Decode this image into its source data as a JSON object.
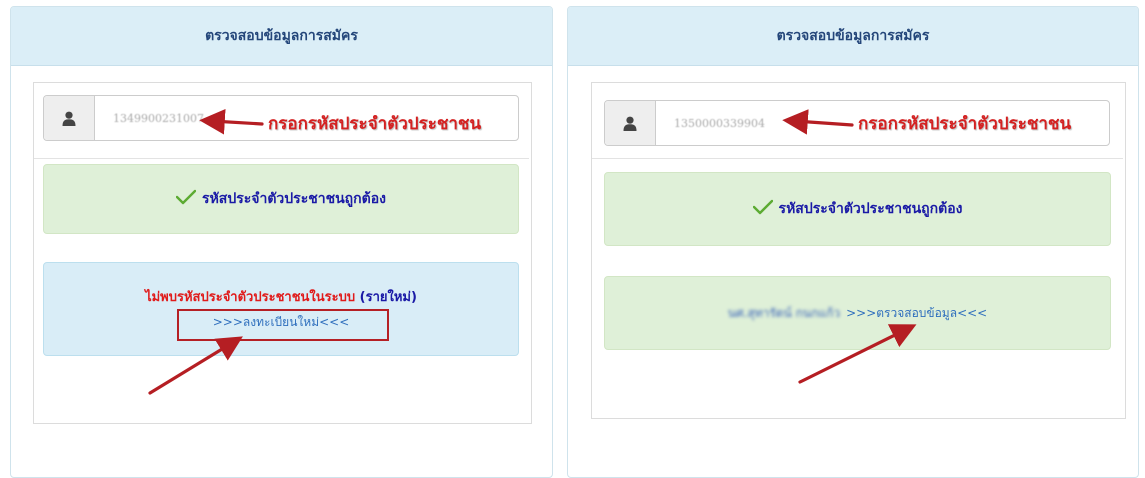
{
  "left_panel": {
    "title": "ตรวจสอบข้อมูลการสมัคร",
    "id_value": "1349900231007",
    "annotation": "กรอกรหัสประจำตัวประชาชน",
    "valid_message": "รหัสประจำตัวประชาชนถูกต้อง",
    "notfound_prefix": "ไม่พบรหัสประจำตัวประชาชนในระบบ",
    "notfound_new": "(รายใหม่)",
    "register_link": ">>>ลงทะเบียนใหม่<<<"
  },
  "right_panel": {
    "title": "ตรวจสอบข้อมูลการสมัคร",
    "id_value": "1350000339904",
    "annotation": "กรอกรหัสประจำตัวประชาชน",
    "valid_message": "รหัสประจำตัวประชาชนถูกต้อง",
    "person_name": "นศ.สุทารัตน์ กนกแก้ว",
    "check_link": ">>>ตรวจสอบข้อมูล<<<"
  },
  "colors": {
    "annotation_red": "#d42121",
    "success_bg": "#dff0d8",
    "info_bg": "#d9edf7",
    "header_bg": "#dbeef7"
  },
  "icons": [
    "user-icon",
    "check-icon",
    "arrow-annotation"
  ]
}
